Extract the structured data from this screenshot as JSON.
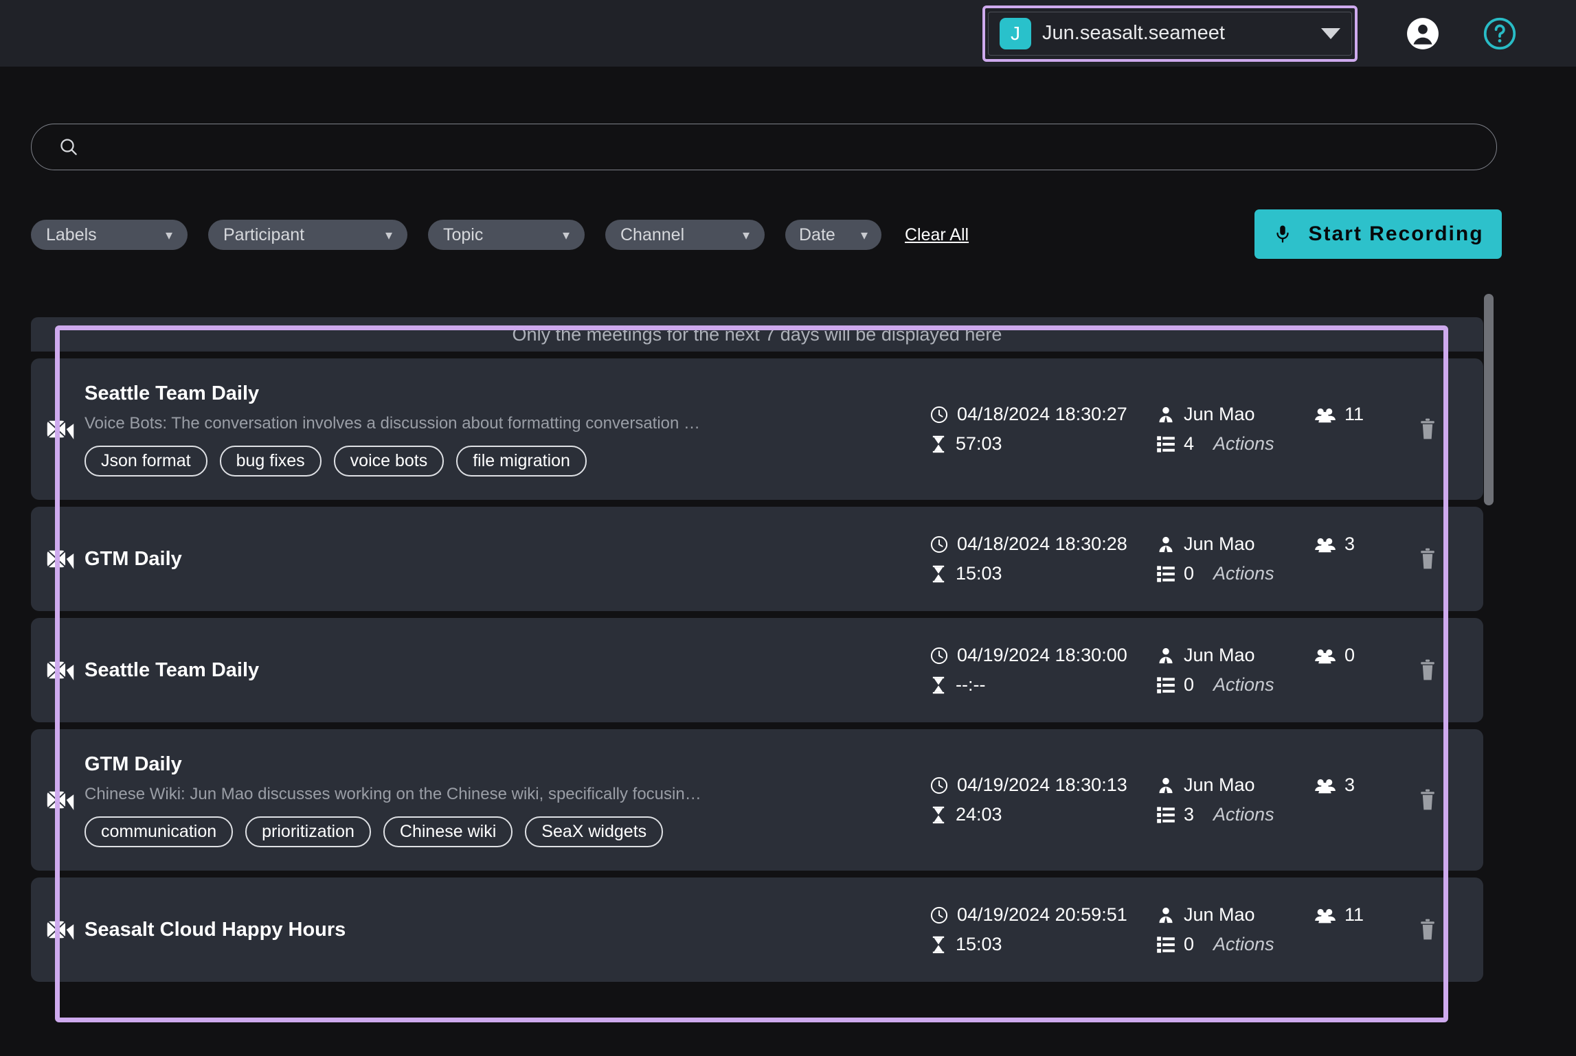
{
  "header": {
    "account": {
      "avatar_letter": "J",
      "name": "Jun.seasalt.seameet"
    },
    "profile_icon": "person-icon",
    "help_icon": "help-circle-icon"
  },
  "search": {
    "value": "",
    "placeholder": ""
  },
  "filters": {
    "items": [
      {
        "label": "Labels"
      },
      {
        "label": "Participant"
      },
      {
        "label": "Topic"
      },
      {
        "label": "Channel"
      },
      {
        "label": "Date"
      }
    ],
    "clear_all": "Clear All"
  },
  "record_button": {
    "label": "Start Recording",
    "icon": "microphone-icon",
    "color": "#2dc1cb"
  },
  "list": {
    "banner": "Only the meetings for the next 7 days will be displayed here",
    "meetings": [
      {
        "title": "Seattle Team Daily",
        "summary": "Voice Bots: The conversation involves a discussion about formatting conversation …",
        "tags": [
          "Json format",
          "bug fixes",
          "voice bots",
          "file migration"
        ],
        "date": "04/18/2024 18:30:27",
        "owner": "Jun Mao",
        "participants": "11",
        "duration": "57:03",
        "actions_count": "4",
        "actions_label": "Actions"
      },
      {
        "title": "GTM Daily",
        "summary": "",
        "tags": [],
        "date": "04/18/2024 18:30:28",
        "owner": "Jun Mao",
        "participants": "3",
        "duration": "15:03",
        "actions_count": "0",
        "actions_label": "Actions"
      },
      {
        "title": "Seattle Team Daily",
        "summary": "",
        "tags": [],
        "date": "04/19/2024 18:30:00",
        "owner": "Jun Mao",
        "participants": "0",
        "duration": "--:--",
        "actions_count": "0",
        "actions_label": "Actions"
      },
      {
        "title": "GTM Daily",
        "summary": "Chinese Wiki: Jun Mao discusses working on the Chinese wiki, specifically focusin…",
        "tags": [
          "communication",
          "prioritization",
          "Chinese wiki",
          "SeaX widgets"
        ],
        "date": "04/19/2024 18:30:13",
        "owner": "Jun Mao",
        "participants": "3",
        "duration": "24:03",
        "actions_count": "3",
        "actions_label": "Actions"
      },
      {
        "title": "Seasalt Cloud Happy Hours",
        "summary": "",
        "tags": [],
        "date": "04/19/2024 20:59:51",
        "owner": "Jun Mao",
        "participants": "11",
        "duration": "15:03",
        "actions_count": "0",
        "actions_label": "Actions"
      }
    ]
  },
  "highlight_color": "#ceaaee"
}
